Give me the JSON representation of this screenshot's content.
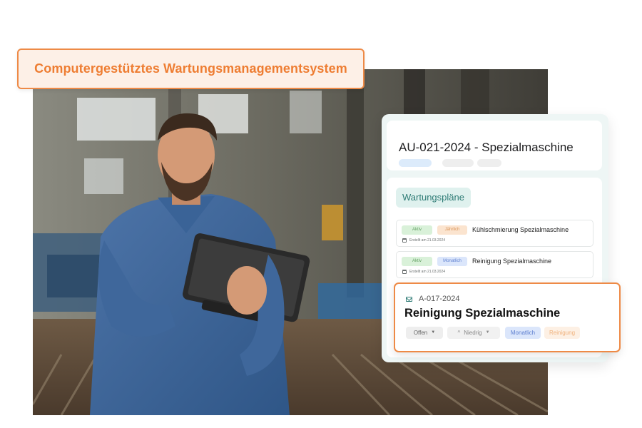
{
  "banner": {
    "title": "Computergestütztes Wartungsmanagementsystem"
  },
  "asset": {
    "title": "AU-021-2024 - Spezialmaschine"
  },
  "maintenance_plans": {
    "heading": "Wartungspläne",
    "items": [
      {
        "status": "Aktiv",
        "frequency": "Jährlich",
        "name": "Kühlschmierung Spezialmaschine",
        "created": "Erstellt am 21.03.2024"
      },
      {
        "status": "Aktiv",
        "frequency": "Monatlich",
        "name": "Reinigung Spezialmaschine",
        "created": "Erstellt am 21.03.2024"
      }
    ]
  },
  "work_order": {
    "id": "A-017-2024",
    "title": "Reinigung Spezialmaschine",
    "status": "Offen",
    "priority": "Niedrig",
    "frequency": "Monatlich",
    "type": "Reinigung"
  },
  "colors": {
    "accent_orange": "#ee8a46",
    "teal": "#2f7c76",
    "panel_bg": "#eef6f5"
  },
  "icons": {
    "work_order": "mail-icon",
    "calendar": "calendar-icon",
    "dropdown": "chevron-down-icon",
    "priority": "chevron-up-icon"
  }
}
